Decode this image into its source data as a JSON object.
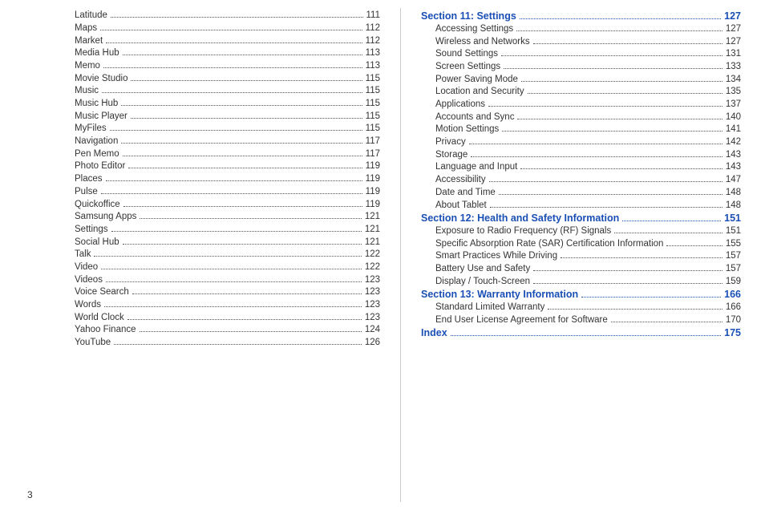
{
  "page_number": "3",
  "left_column": [
    {
      "label": "Latitude",
      "page": "111",
      "level": "sub"
    },
    {
      "label": "Maps",
      "page": "112",
      "level": "sub"
    },
    {
      "label": "Market",
      "page": "112",
      "level": "sub"
    },
    {
      "label": "Media Hub",
      "page": "113",
      "level": "sub"
    },
    {
      "label": "Memo",
      "page": "113",
      "level": "sub"
    },
    {
      "label": "Movie Studio",
      "page": "115",
      "level": "sub"
    },
    {
      "label": "Music",
      "page": "115",
      "level": "sub"
    },
    {
      "label": "Music Hub",
      "page": "115",
      "level": "sub"
    },
    {
      "label": "Music Player",
      "page": "115",
      "level": "sub"
    },
    {
      "label": "MyFiles",
      "page": "115",
      "level": "sub"
    },
    {
      "label": "Navigation",
      "page": "117",
      "level": "sub"
    },
    {
      "label": "Pen Memo",
      "page": "117",
      "level": "sub"
    },
    {
      "label": "Photo Editor",
      "page": "119",
      "level": "sub"
    },
    {
      "label": "Places",
      "page": "119",
      "level": "sub"
    },
    {
      "label": "Pulse",
      "page": "119",
      "level": "sub"
    },
    {
      "label": "Quickoffice",
      "page": "119",
      "level": "sub"
    },
    {
      "label": "Samsung Apps",
      "page": "121",
      "level": "sub"
    },
    {
      "label": "Settings",
      "page": "121",
      "level": "sub"
    },
    {
      "label": "Social Hub",
      "page": "121",
      "level": "sub"
    },
    {
      "label": "Talk",
      "page": "122",
      "level": "sub"
    },
    {
      "label": "Video",
      "page": "122",
      "level": "sub"
    },
    {
      "label": "Videos",
      "page": "123",
      "level": "sub"
    },
    {
      "label": "Voice Search",
      "page": "123",
      "level": "sub"
    },
    {
      "label": "Words",
      "page": "123",
      "level": "sub"
    },
    {
      "label": "World Clock",
      "page": "123",
      "level": "sub"
    },
    {
      "label": "Yahoo Finance",
      "page": "124",
      "level": "sub"
    },
    {
      "label": "YouTube",
      "page": "126",
      "level": "sub"
    }
  ],
  "right_column": [
    {
      "label": "Section 11:  Settings",
      "page": "127",
      "level": "section"
    },
    {
      "label": "Accessing Settings",
      "page": "127",
      "level": "sub"
    },
    {
      "label": "Wireless and Networks",
      "page": "127",
      "level": "sub"
    },
    {
      "label": "Sound Settings",
      "page": "131",
      "level": "sub"
    },
    {
      "label": "Screen Settings",
      "page": "133",
      "level": "sub"
    },
    {
      "label": "Power Saving Mode",
      "page": "134",
      "level": "sub"
    },
    {
      "label": "Location and Security",
      "page": "135",
      "level": "sub"
    },
    {
      "label": "Applications",
      "page": "137",
      "level": "sub"
    },
    {
      "label": "Accounts and Sync",
      "page": "140",
      "level": "sub"
    },
    {
      "label": "Motion Settings",
      "page": "141",
      "level": "sub"
    },
    {
      "label": "Privacy",
      "page": "142",
      "level": "sub"
    },
    {
      "label": "Storage",
      "page": "143",
      "level": "sub"
    },
    {
      "label": "Language and Input",
      "page": "143",
      "level": "sub"
    },
    {
      "label": "Accessibility",
      "page": "147",
      "level": "sub"
    },
    {
      "label": "Date and Time",
      "page": "148",
      "level": "sub"
    },
    {
      "label": "About Tablet",
      "page": "148",
      "level": "sub"
    },
    {
      "label": "Section 12:  Health and Safety Information",
      "page": "151",
      "level": "section"
    },
    {
      "label": "Exposure to Radio Frequency (RF) Signals",
      "page": "151",
      "level": "sub"
    },
    {
      "label": "Specific Absorption Rate (SAR) Certification Information",
      "page": "155",
      "level": "sub"
    },
    {
      "label": "Smart Practices While Driving",
      "page": "157",
      "level": "sub"
    },
    {
      "label": "Battery Use and Safety",
      "page": "157",
      "level": "sub"
    },
    {
      "label": "Display / Touch-Screen",
      "page": "159",
      "level": "sub"
    },
    {
      "label": "Section 13:  Warranty Information",
      "page": "166",
      "level": "section"
    },
    {
      "label": "Standard Limited Warranty",
      "page": "166",
      "level": "sub"
    },
    {
      "label": "End User License Agreement for Software",
      "page": "170",
      "level": "sub"
    },
    {
      "label": "Index",
      "page": "175",
      "level": "section"
    }
  ]
}
